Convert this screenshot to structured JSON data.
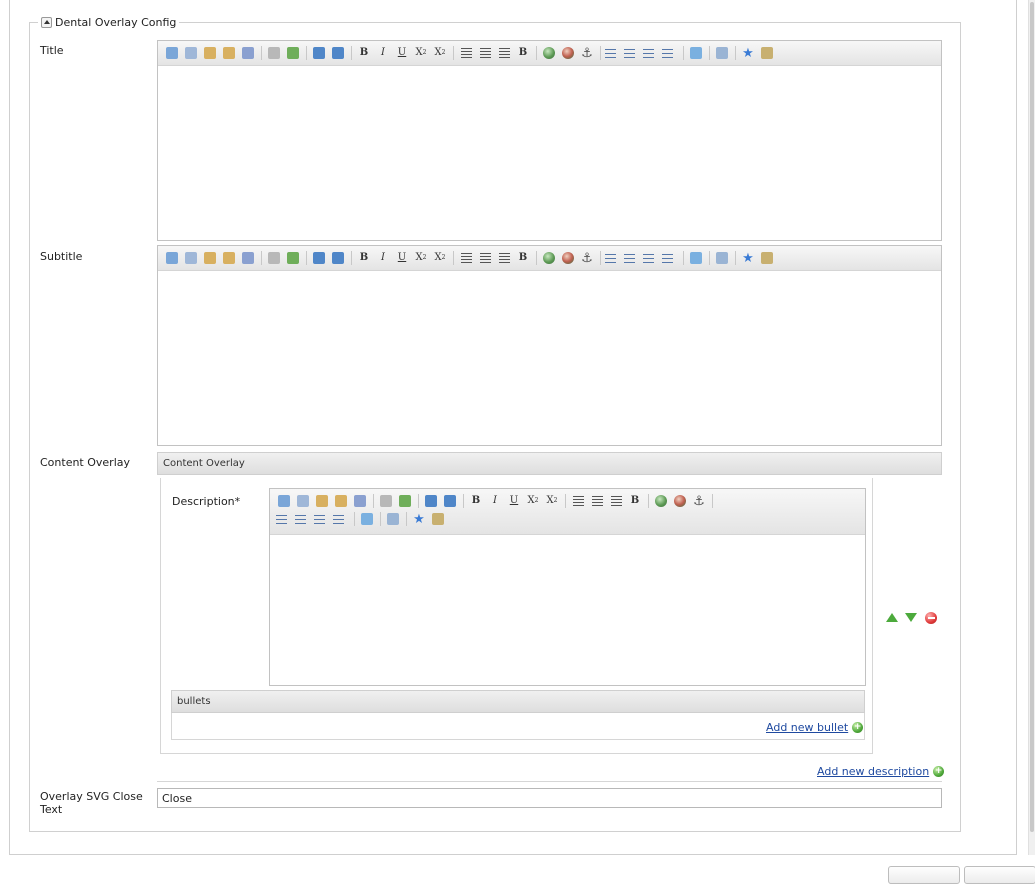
{
  "fieldset": {
    "legend": "Dental Overlay Config"
  },
  "fields": {
    "title_label": "Title",
    "subtitle_label": "Subtitle",
    "content_overlay_label": "Content Overlay",
    "overlay_close_label": "Overlay SVG Close Text",
    "overlay_close_value": "Close"
  },
  "content_overlay": {
    "header": "Content Overlay",
    "description_label": "Description*",
    "bullets_header": "bullets",
    "add_bullet": "Add new bullet",
    "add_description": "Add new description"
  },
  "toolbar_icons": [
    "cut-icon",
    "copy-icon",
    "paste-icon",
    "paste-text-icon",
    "paste-word-icon",
    "unlink-icon",
    "link-icon",
    "undo-icon",
    "redo-icon",
    "bold-icon",
    "italic-icon",
    "underline-icon",
    "subscript-icon",
    "superscript-icon",
    "align-left-icon",
    "align-center-icon",
    "align-right-icon",
    "bold-block-icon",
    "image-icon",
    "flash-icon",
    "anchor-icon",
    "bullet-list-icon",
    "numbered-list-icon",
    "outdent-icon",
    "indent-icon",
    "spellcheck-icon",
    "table-icon",
    "special-char-icon",
    "source-icon"
  ],
  "colors": {
    "link": "#1f4aa0",
    "add": "#4fa83a",
    "remove": "#e03a3a",
    "border": "#c2c2c2"
  }
}
